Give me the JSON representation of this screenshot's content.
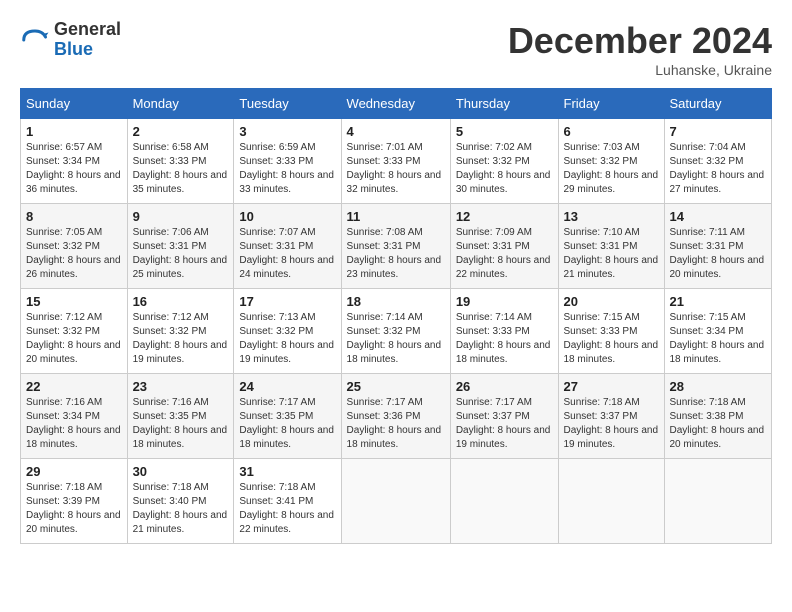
{
  "header": {
    "logo_general": "General",
    "logo_blue": "Blue",
    "month_title": "December 2024",
    "location": "Luhanske, Ukraine"
  },
  "calendar": {
    "days_of_week": [
      "Sunday",
      "Monday",
      "Tuesday",
      "Wednesday",
      "Thursday",
      "Friday",
      "Saturday"
    ],
    "weeks": [
      [
        {
          "day": "1",
          "sunrise": "6:57 AM",
          "sunset": "3:34 PM",
          "daylight": "8 hours and 36 minutes"
        },
        {
          "day": "2",
          "sunrise": "6:58 AM",
          "sunset": "3:33 PM",
          "daylight": "8 hours and 35 minutes"
        },
        {
          "day": "3",
          "sunrise": "6:59 AM",
          "sunset": "3:33 PM",
          "daylight": "8 hours and 33 minutes"
        },
        {
          "day": "4",
          "sunrise": "7:01 AM",
          "sunset": "3:33 PM",
          "daylight": "8 hours and 32 minutes"
        },
        {
          "day": "5",
          "sunrise": "7:02 AM",
          "sunset": "3:32 PM",
          "daylight": "8 hours and 30 minutes"
        },
        {
          "day": "6",
          "sunrise": "7:03 AM",
          "sunset": "3:32 PM",
          "daylight": "8 hours and 29 minutes"
        },
        {
          "day": "7",
          "sunrise": "7:04 AM",
          "sunset": "3:32 PM",
          "daylight": "8 hours and 27 minutes"
        }
      ],
      [
        {
          "day": "8",
          "sunrise": "7:05 AM",
          "sunset": "3:32 PM",
          "daylight": "8 hours and 26 minutes"
        },
        {
          "day": "9",
          "sunrise": "7:06 AM",
          "sunset": "3:31 PM",
          "daylight": "8 hours and 25 minutes"
        },
        {
          "day": "10",
          "sunrise": "7:07 AM",
          "sunset": "3:31 PM",
          "daylight": "8 hours and 24 minutes"
        },
        {
          "day": "11",
          "sunrise": "7:08 AM",
          "sunset": "3:31 PM",
          "daylight": "8 hours and 23 minutes"
        },
        {
          "day": "12",
          "sunrise": "7:09 AM",
          "sunset": "3:31 PM",
          "daylight": "8 hours and 22 minutes"
        },
        {
          "day": "13",
          "sunrise": "7:10 AM",
          "sunset": "3:31 PM",
          "daylight": "8 hours and 21 minutes"
        },
        {
          "day": "14",
          "sunrise": "7:11 AM",
          "sunset": "3:31 PM",
          "daylight": "8 hours and 20 minutes"
        }
      ],
      [
        {
          "day": "15",
          "sunrise": "7:12 AM",
          "sunset": "3:32 PM",
          "daylight": "8 hours and 20 minutes"
        },
        {
          "day": "16",
          "sunrise": "7:12 AM",
          "sunset": "3:32 PM",
          "daylight": "8 hours and 19 minutes"
        },
        {
          "day": "17",
          "sunrise": "7:13 AM",
          "sunset": "3:32 PM",
          "daylight": "8 hours and 19 minutes"
        },
        {
          "day": "18",
          "sunrise": "7:14 AM",
          "sunset": "3:32 PM",
          "daylight": "8 hours and 18 minutes"
        },
        {
          "day": "19",
          "sunrise": "7:14 AM",
          "sunset": "3:33 PM",
          "daylight": "8 hours and 18 minutes"
        },
        {
          "day": "20",
          "sunrise": "7:15 AM",
          "sunset": "3:33 PM",
          "daylight": "8 hours and 18 minutes"
        },
        {
          "day": "21",
          "sunrise": "7:15 AM",
          "sunset": "3:34 PM",
          "daylight": "8 hours and 18 minutes"
        }
      ],
      [
        {
          "day": "22",
          "sunrise": "7:16 AM",
          "sunset": "3:34 PM",
          "daylight": "8 hours and 18 minutes"
        },
        {
          "day": "23",
          "sunrise": "7:16 AM",
          "sunset": "3:35 PM",
          "daylight": "8 hours and 18 minutes"
        },
        {
          "day": "24",
          "sunrise": "7:17 AM",
          "sunset": "3:35 PM",
          "daylight": "8 hours and 18 minutes"
        },
        {
          "day": "25",
          "sunrise": "7:17 AM",
          "sunset": "3:36 PM",
          "daylight": "8 hours and 18 minutes"
        },
        {
          "day": "26",
          "sunrise": "7:17 AM",
          "sunset": "3:37 PM",
          "daylight": "8 hours and 19 minutes"
        },
        {
          "day": "27",
          "sunrise": "7:18 AM",
          "sunset": "3:37 PM",
          "daylight": "8 hours and 19 minutes"
        },
        {
          "day": "28",
          "sunrise": "7:18 AM",
          "sunset": "3:38 PM",
          "daylight": "8 hours and 20 minutes"
        }
      ],
      [
        {
          "day": "29",
          "sunrise": "7:18 AM",
          "sunset": "3:39 PM",
          "daylight": "8 hours and 20 minutes"
        },
        {
          "day": "30",
          "sunrise": "7:18 AM",
          "sunset": "3:40 PM",
          "daylight": "8 hours and 21 minutes"
        },
        {
          "day": "31",
          "sunrise": "7:18 AM",
          "sunset": "3:41 PM",
          "daylight": "8 hours and 22 minutes"
        },
        null,
        null,
        null,
        null
      ]
    ],
    "labels": {
      "sunrise": "Sunrise:",
      "sunset": "Sunset:",
      "daylight": "Daylight:"
    }
  }
}
